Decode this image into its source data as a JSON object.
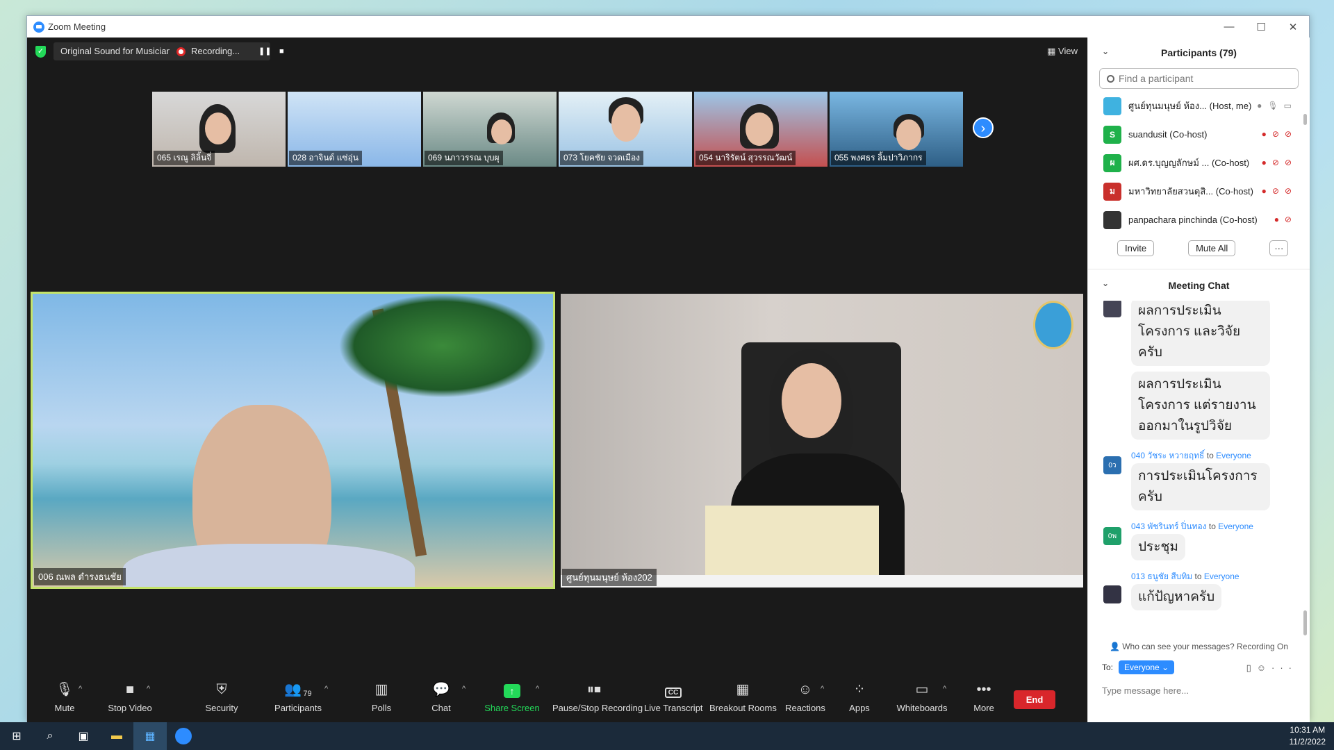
{
  "window": {
    "title": "Zoom Meeting"
  },
  "topbar": {
    "original_sound": "Original Sound for Musicians: Off",
    "recording": "Recording...",
    "view": "View"
  },
  "thumbnails": [
    {
      "name": "065 เรณู ลิลิ้นจี่"
    },
    {
      "name": "028 อาจินต์ แซ่อุ่น"
    },
    {
      "name": "069 นภาวรรณ บุบผุ"
    },
    {
      "name": "073 โยคชัย จวดเมือง"
    },
    {
      "name": "054 นาริรัตน์ สุวรรณวัฒน์"
    },
    {
      "name": "055 พงศธร ลิ้มปาวิภากร"
    }
  ],
  "main_videos": [
    {
      "name": "006 ณพล ดำรงธนชัย"
    },
    {
      "name": "ศูนย์ทุนมนุษย์ ห้อง202"
    }
  ],
  "toolbar": {
    "mute": "Mute",
    "stop_video": "Stop Video",
    "security": "Security",
    "participants": "Participants",
    "participants_count": "79",
    "polls": "Polls",
    "chat": "Chat",
    "share_screen": "Share Screen",
    "pause_stop": "Pause/Stop Recording",
    "live_transcript": "Live Transcript",
    "breakout": "Breakout Rooms",
    "reactions": "Reactions",
    "apps": "Apps",
    "whiteboards": "Whiteboards",
    "more": "More",
    "end": "End"
  },
  "participants_panel": {
    "title": "Participants (79)",
    "search_placeholder": "Find a participant",
    "rows": [
      {
        "name": "ศูนย์ทุนมนุษย์ ห้อง... (Host, me)",
        "avatar": "",
        "color": "#3fb2e0"
      },
      {
        "name": "suandusit (Co-host)",
        "avatar": "S",
        "color": "#1fb14a"
      },
      {
        "name": "ผศ.ดร.บุญญลักษม์ ... (Co-host)",
        "avatar": "ผ",
        "color": "#1fb14a"
      },
      {
        "name": "มหาวิทยาลัยสวนดุสิ... (Co-host)",
        "avatar": "ม",
        "color": "#c9302c"
      },
      {
        "name": "panpachara pinchinda (Co-host)",
        "avatar": "",
        "color": "#333333"
      }
    ],
    "invite": "Invite",
    "mute_all": "Mute All",
    "more": "···"
  },
  "chat": {
    "title": "Meeting Chat",
    "messages": [
      {
        "sender": "",
        "to": "",
        "avatar": "",
        "lines": [
          "ผลการประเมินโครงการ และวิจัยครับ",
          "ผลการประเมินโครงการ แต่รายงานออกมาในรูปวิจัย"
        ]
      },
      {
        "sender": "040 วัชระ หวายฤทธิ์",
        "to": "Everyone",
        "avatar": "0ว",
        "lines": [
          "การประเมินโครงการ ครับ"
        ]
      },
      {
        "sender": "043 พัชรินทร์ ปิ่นทอง",
        "to": "Everyone",
        "avatar": "0พ",
        "lines": [
          "ประชุม"
        ]
      },
      {
        "sender": "013 ธนูชัย สืบทิม",
        "to": "Everyone",
        "avatar": "",
        "lines": [
          "แก้ปัญหาครับ"
        ]
      }
    ],
    "to_word": "to",
    "who_can_see": "Who can see your messages? Recording On",
    "to_label": "To:",
    "recipient": "Everyone",
    "placeholder": "Type message here..."
  },
  "taskbar": {
    "time": "10:31 AM",
    "date": "11/2/2022"
  }
}
